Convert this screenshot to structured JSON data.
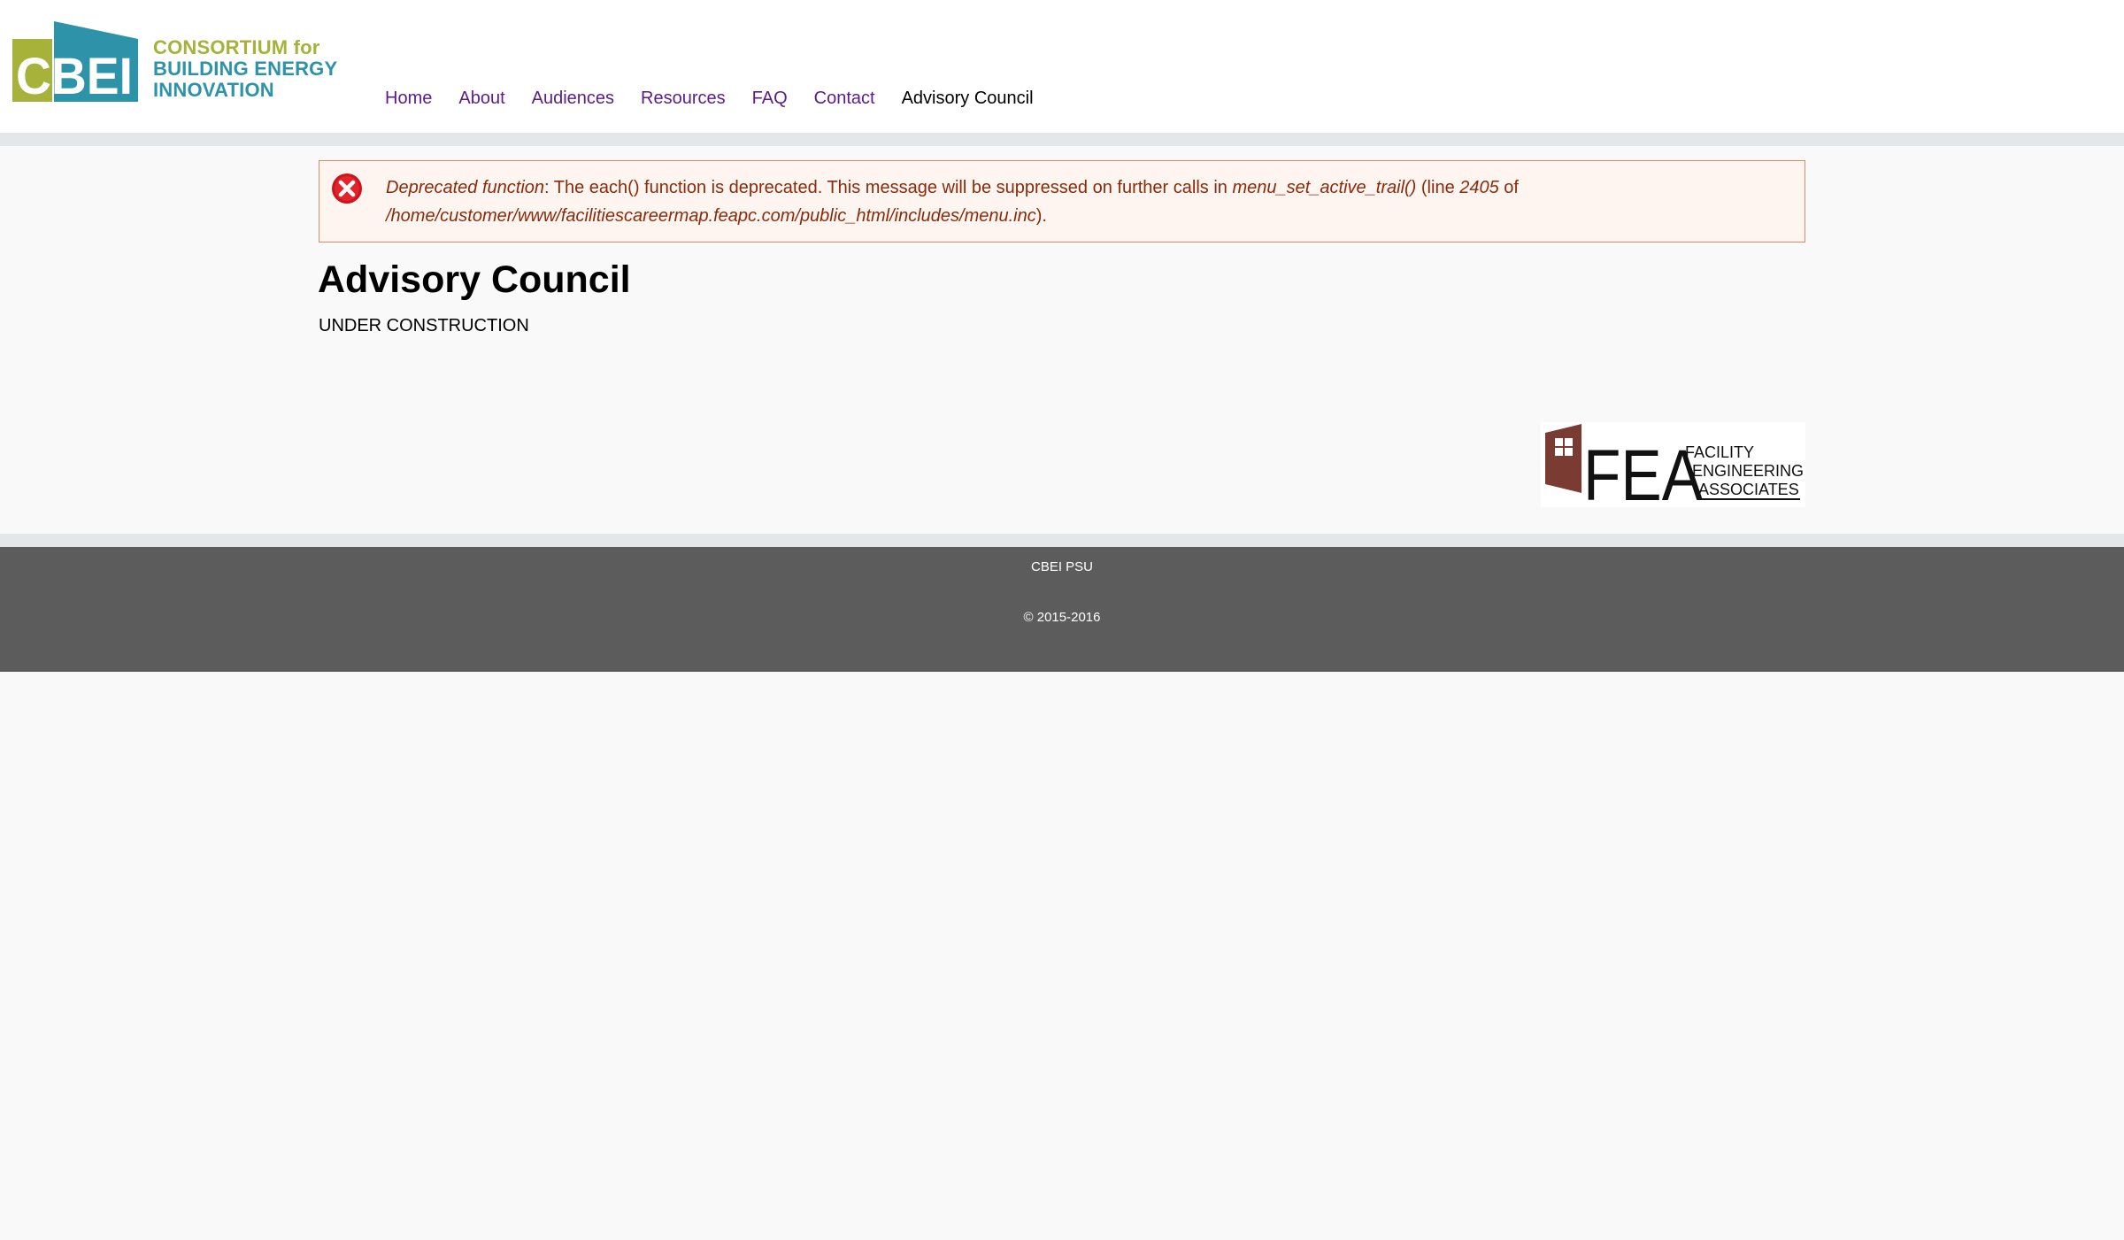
{
  "header": {
    "logo": {
      "mark_text": "CBEI",
      "line1": "CONSORTIUM for",
      "line2": "BUILDING ENERGY",
      "line3": "INNOVATION"
    },
    "nav": [
      {
        "label": "Home"
      },
      {
        "label": "About"
      },
      {
        "label": "Audiences"
      },
      {
        "label": "Resources"
      },
      {
        "label": "FAQ"
      },
      {
        "label": "Contact"
      },
      {
        "label": "Advisory Council"
      }
    ]
  },
  "error": {
    "icon": "error-x-icon",
    "label": "Deprecated function",
    "text1": ": The each() function is deprecated. This message will be suppressed on further calls in ",
    "function": "menu_set_active_trail()",
    "text2": " (line ",
    "line": "2405",
    "text3": " of ",
    "path": "/home/customer/www/facilitiescareermap.feapc.com/public_html/includes/menu.inc",
    "text4": ")."
  },
  "main": {
    "title": "Advisory Council",
    "body": "UNDER CONSTRUCTION"
  },
  "sponsor": {
    "logo_letters": "FEA",
    "line1": "FACILITY",
    "line2": "ENGINEERING",
    "line3": "ASSOCIATES"
  },
  "footer": {
    "org": "CBEI PSU",
    "copyright": "© 2015-2016"
  },
  "colors": {
    "nav_link": "#5a1c8b",
    "nav_active": "#000000",
    "logo_green": "#a6b23a",
    "logo_teal": "#2c93a8",
    "error_text": "#8b2a0a",
    "error_border": "#e2876a",
    "error_bg": "#fef5f1",
    "footer_bg": "#5c5c5c",
    "fea_brown": "#7a3b32"
  }
}
